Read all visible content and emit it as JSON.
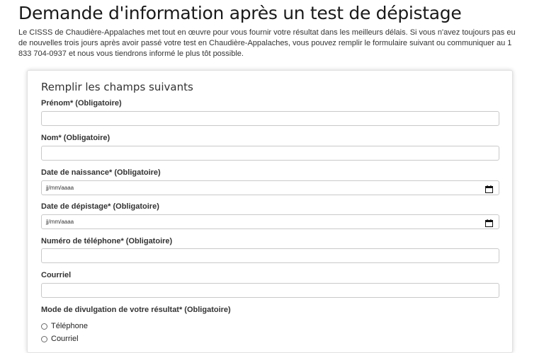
{
  "page": {
    "title": "Demande d'information après un test de dépistage",
    "intro": "Le CISSS de Chaudière-Appalaches met tout en œuvre pour vous fournir votre résultat dans les meilleurs délais. Si vous n'avez toujours pas eu de nouvelles trois jours après avoir passé votre test en Chaudière-Appalaches, vous pouvez remplir le formulaire suivant ou communiquer au 1 833 704-0937 et nous vous tiendrons informé le plus tôt possible."
  },
  "form": {
    "title": "Remplir les champs suivants",
    "fields": [
      {
        "label": "Prénom* (Obligatoire)",
        "value": ""
      },
      {
        "label": "Nom* (Obligatoire)",
        "value": ""
      },
      {
        "label": "Date de naissance* (Obligatoire)",
        "placeholder": "jj/mm/aaaa"
      },
      {
        "label": "Date de dépistage* (Obligatoire)",
        "placeholder": "jj/mm/aaaa"
      },
      {
        "label": "Numéro de téléphone* (Obligatoire)",
        "value": ""
      },
      {
        "label": "Courriel",
        "value": ""
      }
    ],
    "disclosure": {
      "label": "Mode de divulgation de votre résultat* (Obligatoire)",
      "options": [
        {
          "label": "Téléphone",
          "selected": false
        },
        {
          "label": "Courriel",
          "selected": false
        }
      ]
    }
  },
  "icons": {
    "calendar": "calendar-icon"
  }
}
